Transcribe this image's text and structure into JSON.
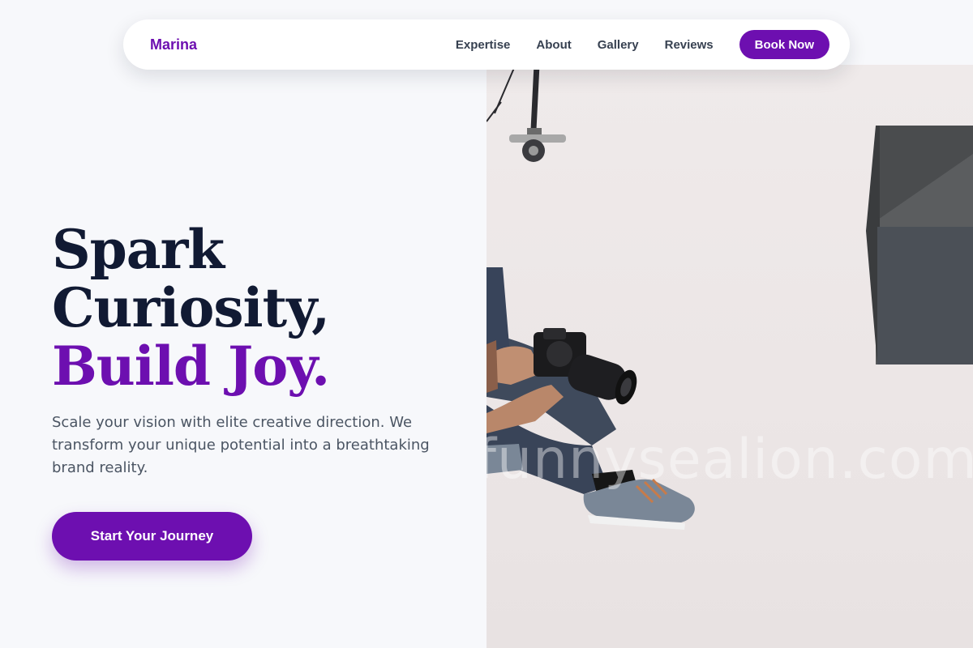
{
  "nav": {
    "brand": "Marina",
    "links": [
      {
        "label": "Expertise"
      },
      {
        "label": "About"
      },
      {
        "label": "Gallery"
      },
      {
        "label": "Reviews"
      }
    ],
    "cta": "Book Now"
  },
  "hero": {
    "title_line1": "Spark",
    "title_line2": "Curiosity,",
    "title_accent": "Build Joy.",
    "subtitle": "Scale your vision with elite creative direction. We transform your unique potential into a breathtaking brand reality.",
    "cta": "Start Your Journey",
    "image_watermark": "funnysealion.com"
  },
  "colors": {
    "accent": "#6d0fb0",
    "heading": "#111a33",
    "body_text": "#4b5563",
    "background": "#f7f8fb"
  }
}
